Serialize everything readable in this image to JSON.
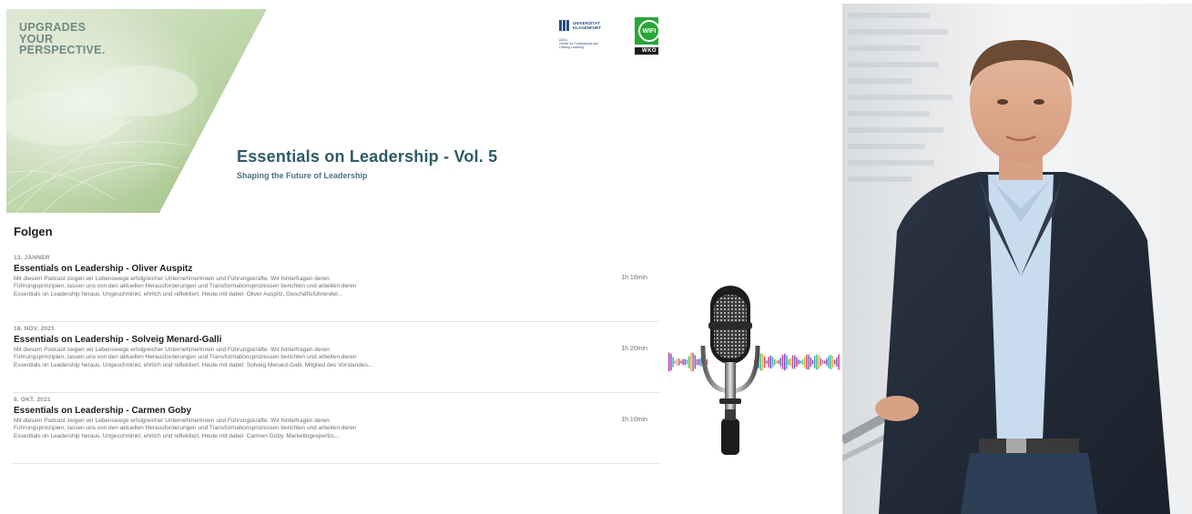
{
  "banner": {
    "tagline": [
      "UPGRADES",
      "YOUR",
      "PERSPECTIVE."
    ],
    "title": "Essentials on Leadership - Vol. 5",
    "subtitle": "Shaping the Future of Leadership",
    "logo_uni": {
      "name_line1": "UNIVERSITÄT",
      "name_line2": "KLAGENFURT",
      "sub_lines": [
        "AACs",
        "Center for Professional and",
        "Lifelong Learning"
      ]
    },
    "logo_wifi": {
      "mark": "WIFI",
      "org": "WKO"
    }
  },
  "episodes_section": {
    "title": "Folgen",
    "items": [
      {
        "date": "13. JÄNNER",
        "title": "Essentials on Leadership - Oliver Auspitz",
        "desc_lines": [
          "Mit diesem Podcast zeigen wir Lebenswege erfolgreicher UnternehmerInnen und Führungskräfte. Wir hinterfragen deren",
          "Führungsprinzipien, lassen uns von den aktuellen Herausforderungen und Transformationsprozessen berichten und arbeiten deren",
          "Essentials on Leadership heraus.  Ungeschminkt, ehrlich und reflektiert. Heute mit dabei:  Oliver Auspitz, Geschäftsführender..."
        ],
        "duration": "1h 16min"
      },
      {
        "date": "18. NOV. 2021",
        "title": "Essentials on Leadership - Solveig Menard-Galli",
        "desc_lines": [
          "Mit diesem Podcast zeigen wir Lebenswege erfolgreicher UnternehmerInnen und Führungskräfte. Wir hinterfragen deren",
          "Führungsprinzipien, lassen uns von den aktuellen Herausforderungen und Transformationsprozessen berichten und arbeiten deren",
          "Essentials on Leadership heraus.  Ungeschminkt, ehrlich und reflektiert. Heute mit dabei:  Solveig Menard-Galli, Mitglied des Vorstandes..."
        ],
        "duration": "1h 20min"
      },
      {
        "date": "8. OKT. 2021",
        "title": "Essentials on Leadership - Carmen Goby",
        "desc_lines": [
          "Mit diesem Podcast zeigen wir Lebenswege erfolgreicher UnternehmerInnen und Führungskräfte. Wir hinterfragen deren",
          "Führungsprinzipien, lassen uns von den aktuellen Herausforderungen und Transformationsprozessen berichten und arbeiten deren",
          "Essentials on Leadership heraus.  Ungeschminkt, ehrlich und reflektiert. Heute mit dabei:  Carmen Goby, Marketingexpertin,..."
        ],
        "duration": "1h 10min"
      }
    ]
  },
  "icons": {
    "microphone": "microphone-icon",
    "soundwave": "soundwave-graphic"
  },
  "colors": {
    "banner_green": "#b9d3a6",
    "title_teal": "#2f5b67",
    "uni_blue": "#2c4e8a",
    "wifi_green": "#29a637"
  }
}
